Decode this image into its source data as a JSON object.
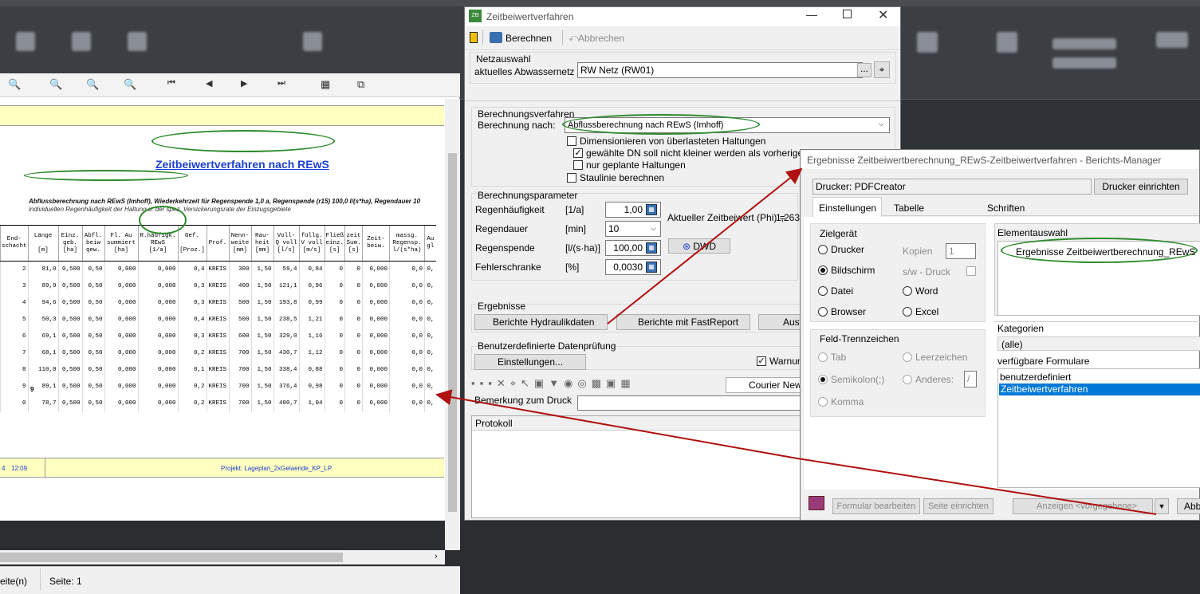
{
  "preview": {
    "report_title": "Zeitbeiwertverfahren nach REwS",
    "subtitle_line1": "Abflussberechnung nach REwS (Imhoff), Wiederkehrzeit für Regenspende 1,0 a, Regenspende (r15) 100,0 l/(s*ha), Regendauer 10",
    "subtitle_line2": "individuellen Regenhäufigkeit der Haltung u. der spez. Versickerungsrate der Einzugsgebiete",
    "columns": [
      "End-\nschacht",
      "Länge\n\n[m]",
      "Einz.\ngeb.\n[ha]",
      "Abfl.\nbeiw\nqew.",
      "Fl. Au\nsummiert\n[ha]",
      "R.häufigk.\nREwS\n[1/a]",
      "Gef.\n\n[Proz.]",
      "Prof.",
      "Nenn-\nweite\n[mm]",
      "Rau-\nheit\n[mm]",
      "Voll-\nQ voll\n[l/s]",
      "füllg.\nV voll\n[m/s]",
      "Fließ\neinz.\n[s]",
      "zeit\nSum.\n[s]",
      "Zeit-\nbeiw.",
      "massg.\nRegensp.\nl/(s*ha)",
      "Au\ngl"
    ],
    "rows": [
      [
        "2",
        "81,0",
        "0,500",
        "0,50",
        "0,000",
        "0,000",
        "0,4",
        "KREIS",
        "300",
        "1,50",
        "59,4",
        "0,84",
        "0",
        "0",
        "0,000",
        "0,0",
        "0,"
      ],
      [
        "3",
        "89,9",
        "0,500",
        "0,50",
        "0,000",
        "0,000",
        "0,3",
        "KREIS",
        "400",
        "1,50",
        "121,1",
        "0,96",
        "0",
        "0",
        "0,000",
        "0,0",
        "0,"
      ],
      [
        "4",
        "94,6",
        "0,500",
        "0,50",
        "0,000",
        "0,000",
        "0,3",
        "KREIS",
        "500",
        "1,50",
        "193,8",
        "0,99",
        "0",
        "0",
        "0,000",
        "0,0",
        "0,"
      ],
      [
        "5",
        "50,3",
        "0,500",
        "0,50",
        "0,000",
        "0,000",
        "0,4",
        "KREIS",
        "500",
        "1,50",
        "238,5",
        "1,21",
        "0",
        "0",
        "0,000",
        "0,0",
        "0,"
      ],
      [
        "6",
        "69,1",
        "0,500",
        "0,50",
        "0,000",
        "0,000",
        "0,3",
        "KREIS",
        "600",
        "1,50",
        "329,0",
        "1,16",
        "0",
        "0",
        "0,000",
        "0,0",
        "0,"
      ],
      [
        "7",
        "68,1",
        "0,500",
        "0,50",
        "0,000",
        "0,000",
        "0,2",
        "KREIS",
        "700",
        "1,50",
        "430,7",
        "1,12",
        "0",
        "0",
        "0,000",
        "0,0",
        "0,"
      ],
      [
        "8",
        "110,0",
        "0,500",
        "0,50",
        "0,000",
        "0,000",
        "0,1",
        "KREIS",
        "700",
        "1,50",
        "338,4",
        "0,88",
        "0",
        "0",
        "0,000",
        "0,0",
        "0,"
      ],
      [
        "9",
        "89,1",
        "0,500",
        "0,50",
        "0,000",
        "0,000",
        "0,2",
        "KREIS",
        "700",
        "1,50",
        "376,4",
        "0,98",
        "0",
        "0",
        "0,000",
        "0,0",
        "0,"
      ],
      [
        "0",
        "78,7",
        "0,500",
        "0,50",
        "0,000",
        "0,000",
        "0,2",
        "KREIS",
        "700",
        "1,50",
        "400,7",
        "1,04",
        "0",
        "0",
        "0,000",
        "0,0",
        "0,"
      ]
    ],
    "count": "9",
    "footer_date": "4",
    "footer_time": "12:09",
    "footer_project": "Projekt: Lageplan_2xGelaende_KP_LP",
    "status_left": "eite(n)",
    "status_page": "Seite: 1"
  },
  "dialog": {
    "title": "Zeitbeiwertverfahren",
    "calc_label": "Berechnen",
    "abort_label": "Abbrechen",
    "netz": {
      "group": "Netzauswahl",
      "label": "aktuelles Abwassernetz",
      "value": "RW Netz (RW01)",
      "dots": "..."
    },
    "verfahren": {
      "group": "Berechnungsverfahren",
      "label": "Berechnung nach:",
      "value": "Abflussberechnung nach REwS (Imhoff)",
      "opt1": "Dimensionieren von überlasteten Haltungen",
      "opt2": "gewählte DN soll nicht kleiner werden als vorherige Haltung",
      "opt3": "nur geplante Haltungen",
      "opt4": "Staulinie berechnen"
    },
    "param": {
      "group": "Berechnungsparameter",
      "rows": [
        {
          "label": "Regenhäufigkeit",
          "unit": "[1/a]",
          "value": "1,00"
        },
        {
          "label": "Regendauer",
          "unit": "[min]",
          "value": "10"
        },
        {
          "label": "Regenspende",
          "unit": "[l/(s·ha)]",
          "value": "100,00"
        },
        {
          "label": "Fehlerschranke",
          "unit": "[%]",
          "value": "0,0030"
        }
      ],
      "phi_label": "Aktueller Zeitbeiwert (Phi) =",
      "phi_value": "1,263",
      "dwd": "DWD"
    },
    "ergebnisse": {
      "group": "Ergebnisse",
      "btn1": "Berichte Hydraulikdaten",
      "btn2": "Berichte mit FastReport",
      "btn3": "Ausw"
    },
    "pruefung": {
      "group": "Benutzerdefinierte Datenprüfung",
      "btn": "Einstellungen...",
      "warn": "Warnung"
    },
    "font": "Courier New",
    "remark_label": "Bemerkung zum Druck",
    "protocol": "Protokoll"
  },
  "bm": {
    "title": "Ergebnisse Zeitbeiwertberechnung_REwS-Zeitbeiwertverfahren - Berichts-Manager",
    "printer_label": "Drucker:",
    "printer_value": "PDFCreator",
    "printer_btn": "Drucker einrichten",
    "tabs": [
      "Einstellungen",
      "Tabelle",
      "Schriften"
    ],
    "ziel": {
      "group": "Zielgerät",
      "drucker": "Drucker",
      "kopien": "Kopien",
      "kopien_value": "1",
      "bildschirm": "Bildschirm",
      "sw": "s/w - Druck",
      "datei": "Datei",
      "word": "Word",
      "browser": "Browser",
      "excel": "Excel"
    },
    "feld": {
      "group": "Feld-Trennzeichen",
      "tab": "Tab",
      "leer": "Leerzeichen",
      "semi": "Semikolon(;)",
      "anderes": "Anderes:",
      "anderes_value": "/",
      "komma": "Komma"
    },
    "elementauswahl": "Elementauswahl",
    "element": "Ergebnisse Zeitbeiwertberechnung_REwS",
    "kategorien": "Kategorien",
    "kategorie_value": "(alle)",
    "formulare": "verfügbare Formulare",
    "formular_items": [
      "benutzerdefiniert",
      "Zeitbeiwertverfahren"
    ],
    "btn_formular": "Formular bearbeiten",
    "btn_seite": "Seite einrichten",
    "btn_anzeigen": "Anzeigen <vorgegebene>",
    "btn_abb": "Abb"
  },
  "colors": {
    "accent_green": "#2c8a2c",
    "arrow_red": "#b01010",
    "report_blue": "#1a3fd1",
    "selection": "#0078d7"
  }
}
